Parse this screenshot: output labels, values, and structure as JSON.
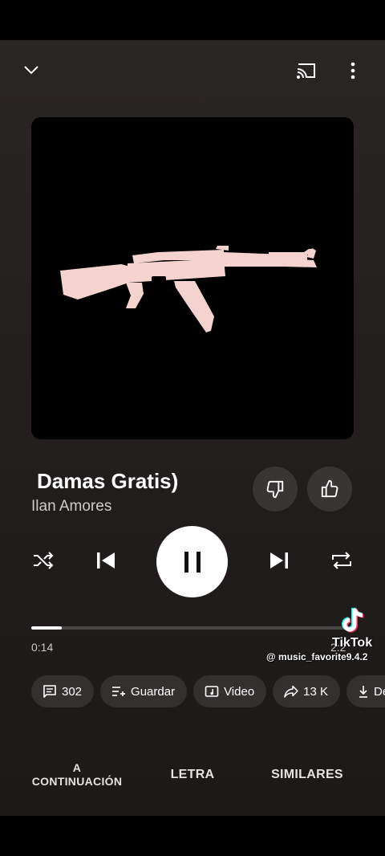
{
  "song": {
    "title": " Damas Gratis)",
    "artist": "Ilan Amores"
  },
  "playback": {
    "elapsed": "0:14",
    "duration": "2:2",
    "progress": 0.095,
    "state": "playing"
  },
  "chips": [
    {
      "icon": "comment-icon",
      "label": "302"
    },
    {
      "icon": "add-to-playlist-icon",
      "label": "Guardar"
    },
    {
      "icon": "video-icon",
      "label": "Video"
    },
    {
      "icon": "share-icon",
      "label": "13 K"
    },
    {
      "icon": "download-icon",
      "label": "De"
    }
  ],
  "tabs": {
    "up_next": "A\nCONTINUACIÓN",
    "lyrics": "LETRA",
    "related": "SIMILARES"
  },
  "watermark": {
    "brand": "TikTok",
    "handle": "@ music_favorite9.4.2"
  },
  "colors": {
    "background": "#231f1f",
    "artwork_bg": "#000000",
    "artwork_figure": "#f4d3cf",
    "accent": "#ffffff"
  },
  "icons": {
    "collapse": "chevron-down-icon",
    "cast": "cast-icon",
    "more": "more-vert-icon",
    "dislike": "thumbs-down-icon",
    "like": "thumbs-up-icon",
    "shuffle": "shuffle-icon",
    "previous": "skip-previous-icon",
    "pause": "pause-icon",
    "next": "skip-next-icon",
    "repeat": "repeat-icon"
  }
}
